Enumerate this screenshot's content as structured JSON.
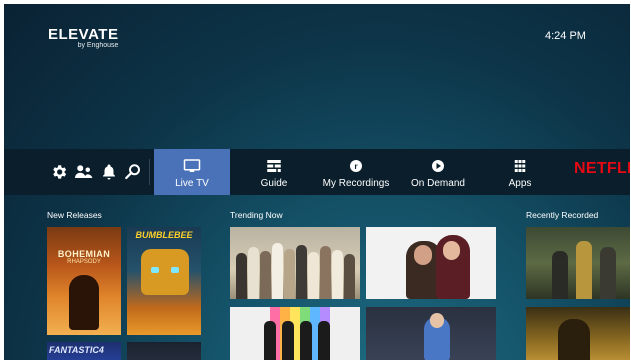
{
  "brand": {
    "name": "ELEVATE",
    "sub": "by Enghouse"
  },
  "clock": "4:24 PM",
  "menu": {
    "tabs": [
      {
        "id": "live-tv",
        "label": "Live TV",
        "icon": "tv-icon",
        "active": true
      },
      {
        "id": "guide",
        "label": "Guide",
        "icon": "guide-grid-icon",
        "active": false
      },
      {
        "id": "my-recordings",
        "label": "My Recordings",
        "icon": "record-icon",
        "active": false
      },
      {
        "id": "on-demand",
        "label": "On Demand",
        "icon": "play-circle-icon",
        "active": false
      },
      {
        "id": "apps",
        "label": "Apps",
        "icon": "apps-grid-icon",
        "active": false
      }
    ],
    "netflix": "NETFLIX",
    "left_icons": [
      "gear-icon",
      "profiles-icon",
      "bell-icon",
      "search-icon"
    ]
  },
  "rows": {
    "new_releases": {
      "title": "New Releases",
      "posters": [
        {
          "title_line1": "BOHEMIAN",
          "title_line2": "RHAPSODY"
        },
        {
          "title_line1": "BUMBLEBEE"
        },
        {
          "title_line1": "FANTASTIC4"
        },
        {
          "title_line1": ""
        }
      ]
    },
    "trending_now": {
      "title": "Trending Now"
    },
    "recently_recorded": {
      "title": "Recently Recorded"
    }
  },
  "colors": {
    "active_tab": "#4a72b9",
    "menu_bar": "#0a1e2b",
    "netflix": "#e50914"
  }
}
